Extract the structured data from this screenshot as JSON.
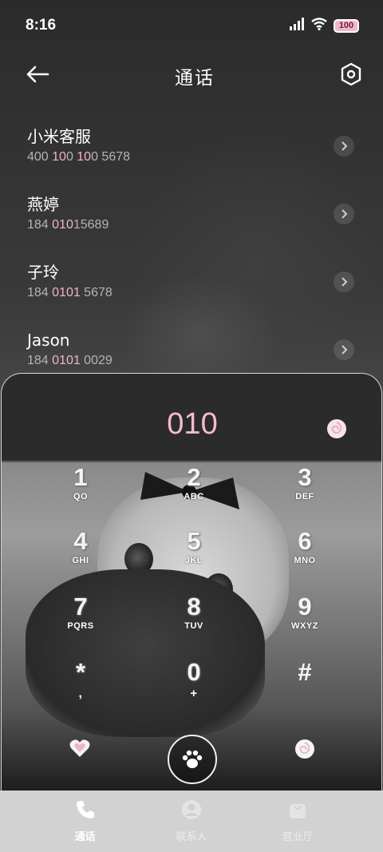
{
  "status_bar": {
    "time": "8:16",
    "battery": "100"
  },
  "header": {
    "title": "通话"
  },
  "contacts": [
    {
      "name": "小米客服",
      "number_parts": [
        "400 ",
        "10",
        "0 ",
        "10",
        "0 5678"
      ]
    },
    {
      "name": "燕婷",
      "number_parts": [
        "184 ",
        "010",
        "15689"
      ]
    },
    {
      "name": "子玲",
      "number_parts": [
        "184 ",
        "0101",
        " 5678"
      ]
    },
    {
      "name": "Jason",
      "number_parts": [
        "184 ",
        "0101",
        " 0029"
      ]
    }
  ],
  "dialer": {
    "input": "010",
    "keys": [
      {
        "digit": "1",
        "letters": "QO"
      },
      {
        "digit": "2",
        "letters": "ABC"
      },
      {
        "digit": "3",
        "letters": "DEF"
      },
      {
        "digit": "4",
        "letters": "GHI"
      },
      {
        "digit": "5",
        "letters": "JKL"
      },
      {
        "digit": "6",
        "letters": "MNO"
      },
      {
        "digit": "7",
        "letters": "PQRS"
      },
      {
        "digit": "8",
        "letters": "TUV"
      },
      {
        "digit": "9",
        "letters": "WXYZ"
      },
      {
        "digit": "*",
        "letters": ","
      },
      {
        "digit": "0",
        "letters": "+"
      },
      {
        "digit": "#",
        "letters": ""
      }
    ]
  },
  "bottom_nav": [
    {
      "label": "通话",
      "icon": "phone-icon",
      "active": true
    },
    {
      "label": "联系人",
      "icon": "person-icon",
      "active": false
    },
    {
      "label": "营业厅",
      "icon": "bag-icon",
      "active": false
    }
  ],
  "colors": {
    "accent_pink": "#f4bccc",
    "number_highlight": "#f1b3c9"
  }
}
